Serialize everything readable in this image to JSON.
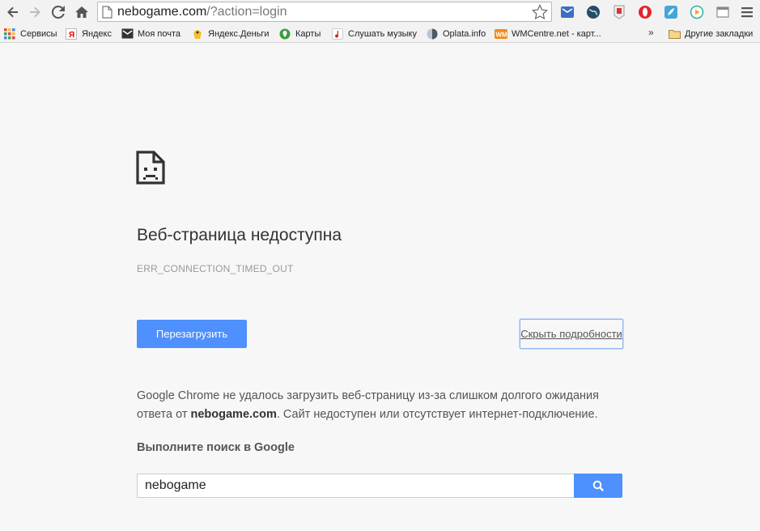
{
  "browser": {
    "url_host": "nebogame.com",
    "url_path": "/?action=login",
    "bookmarks": [
      {
        "label": "Сервисы",
        "icon": "apps-grid-icon"
      },
      {
        "label": "Яндекс",
        "icon": "yandex-icon"
      },
      {
        "label": "Моя почта",
        "icon": "mail-icon"
      },
      {
        "label": "Яндекс.Деньги",
        "icon": "yandex-money-icon"
      },
      {
        "label": "Карты",
        "icon": "maps-icon"
      },
      {
        "label": "Слушать музыку",
        "icon": "music-icon"
      },
      {
        "label": "Oplata.info",
        "icon": "oplata-icon"
      },
      {
        "label": "WMCentre.net - карт...",
        "icon": "wmcentre-icon"
      }
    ],
    "more_chevron": "»",
    "other_bookmarks": "Другие закладки"
  },
  "error": {
    "title": "Веб-страница недоступна",
    "code": "ERR_CONNECTION_TIMED_OUT",
    "reload_label": "Перезагрузить",
    "details_label": "Скрыть подробности",
    "desc_part1": "Google Chrome не удалось загрузить веб-страницу из-за слишком долгого ожидания ответа от ",
    "desc_host": "nebogame.com",
    "desc_part2": ". Сайт недоступен или отсутствует интернет-подключение."
  },
  "search": {
    "heading": "Выполните поиск в Google",
    "value": "nebogame"
  },
  "colors": {
    "accent": "#4d90fe",
    "page_bg": "#f7f7f7"
  }
}
